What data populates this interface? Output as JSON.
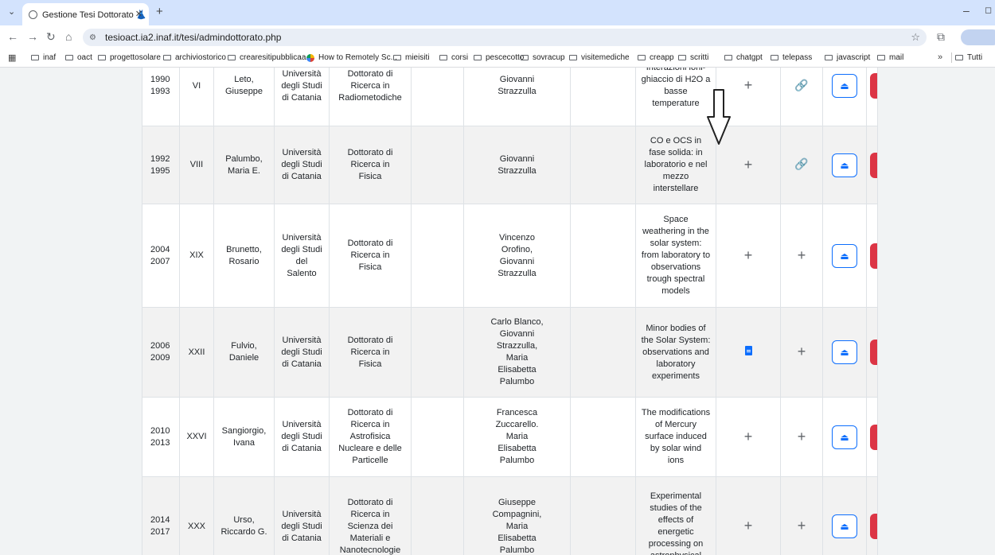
{
  "browser": {
    "tab_title": "Gestione Tesi Dottorato 👗",
    "url": "tesioact.ia2.inaf.it/tesi/admindottorato.php",
    "bookmarks": [
      "inaf",
      "oact",
      "progettosolare",
      "archiviostorico",
      "crearesitipubblicaa...",
      "How to Remotely Sc...",
      "mieisiti",
      "corsi",
      "pescecotto",
      "sovracup",
      "visitemediche",
      "creapp",
      "scritti",
      "chatgpt",
      "telepass",
      "javascript",
      "mail"
    ],
    "bookmarks_more": "»",
    "bookmarks_other": "Tutti"
  },
  "table": {
    "rows": [
      {
        "anni": [
          "1990",
          "1993"
        ],
        "ciclo": "VI",
        "dottorando": [
          "Leto,",
          "Giuseppe"
        ],
        "universita": [
          "Università",
          "degli Studi",
          "di Catania"
        ],
        "corso": [
          "Dottorato di",
          "Ricerca in",
          "Radiometodiche"
        ],
        "tutor": [
          "Giovanni",
          "Strazzulla"
        ],
        "titolo": [
          "Interazioni ioni-",
          "ghiaccio di H2O a",
          "basse",
          "temperature"
        ],
        "azione1": "plus",
        "azione2": "link"
      },
      {
        "anni": [
          "1992",
          "1995"
        ],
        "ciclo": "VIII",
        "dottorando": [
          "Palumbo,",
          "Maria E."
        ],
        "universita": [
          "Università",
          "degli Studi",
          "di Catania"
        ],
        "corso": [
          "Dottorato di",
          "Ricerca in",
          "Fisica"
        ],
        "tutor": [
          "Giovanni",
          "Strazzulla"
        ],
        "titolo": [
          "CO e OCS in",
          "fase solida: in",
          "laboratorio e nel",
          "mezzo",
          "interstellare"
        ],
        "azione1": "plus",
        "azione2": "link"
      },
      {
        "anni": [
          "2004",
          "2007"
        ],
        "ciclo": "XIX",
        "dottorando": [
          "Brunetto,",
          "Rosario"
        ],
        "universita": [
          "Università",
          "degli Studi",
          "del",
          "Salento"
        ],
        "corso": [
          "Dottorato di",
          "Ricerca in",
          "Fisica"
        ],
        "tutor": [
          "Vincenzo",
          "Orofino,",
          "Giovanni",
          "Strazzulla"
        ],
        "titolo": [
          "Space",
          "weathering in the",
          "solar system:",
          "from laboratory to",
          "observations",
          "trough spectral",
          "models"
        ],
        "azione1": "plus",
        "azione2": "plus"
      },
      {
        "anni": [
          "2006",
          "2009"
        ],
        "ciclo": "XXII",
        "dottorando": [
          "Fulvio,",
          "Daniele"
        ],
        "universita": [
          "Università",
          "degli Studi",
          "di Catania"
        ],
        "corso": [
          "Dottorato di",
          "Ricerca in",
          "Fisica"
        ],
        "tutor": [
          "Carlo Blanco,",
          "Giovanni",
          "Strazzulla,",
          "Maria",
          "Elisabetta",
          "Palumbo"
        ],
        "titolo": [
          "Minor bodies of",
          "the Solar System:",
          "observations and",
          "laboratory",
          "experiments"
        ],
        "azione1": "doc",
        "azione2": "plus"
      },
      {
        "anni": [
          "2010",
          "2013"
        ],
        "ciclo": "XXVI",
        "dottorando": [
          "Sangiorgio,",
          "Ivana"
        ],
        "universita": [
          "Università",
          "degli Studi",
          "di Catania"
        ],
        "corso": [
          "Dottorato di",
          "Ricerca in",
          "Astrofisica",
          "Nucleare e delle",
          "Particelle"
        ],
        "tutor": [
          "Francesca",
          "Zuccarello.",
          "Maria",
          "Elisabetta",
          "Palumbo"
        ],
        "titolo": [
          "The modifications",
          "of Mercury",
          "surface induced",
          "by solar wind",
          "ions"
        ],
        "azione1": "plus",
        "azione2": "plus"
      },
      {
        "anni": [
          "2014",
          "2017"
        ],
        "ciclo": "XXX",
        "dottorando": [
          "Urso,",
          "Riccardo G."
        ],
        "universita": [
          "Università",
          "degli Studi",
          "di Catania"
        ],
        "corso": [
          "Dottorato di",
          "Ricerca in",
          "Scienza dei",
          "Materiali e",
          "Nanotecnologie"
        ],
        "tutor": [
          "Giuseppe",
          "Compagnini,",
          "Maria",
          "Elisabetta",
          "Palumbo"
        ],
        "titolo": [
          "Experimental",
          "studies of the",
          "effects of",
          "energetic",
          "processing on",
          "astrophysical"
        ],
        "azione1": "plus",
        "azione2": "plus"
      }
    ]
  },
  "colors": {
    "upload_border": "#0d6efd",
    "delete_bg": "#dc3545",
    "link_icon": "#17a2b8",
    "row_shaded": "#f2f2f2"
  }
}
